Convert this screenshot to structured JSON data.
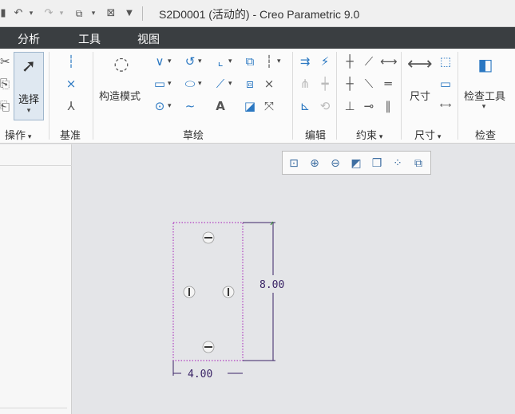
{
  "title_bar": {
    "title": "S2D0001 (活动的) - Creo Parametric 9.0"
  },
  "menu": {
    "items": [
      "分析",
      "工具",
      "视图"
    ]
  },
  "ribbon": {
    "select_label": "选择",
    "construction_mode_label": "构造模式",
    "dimension_label": "尺寸",
    "inspect_tools_label": "检查工具",
    "groups": {
      "operations": "操作",
      "datum": "基准",
      "sketch": "草绘",
      "edit": "编辑",
      "constraints": "约束",
      "dimension": "尺寸",
      "inspect": "检查"
    }
  },
  "sketch": {
    "width_dimension": "4.00",
    "height_dimension": "8.00"
  },
  "colors": {
    "menubar": "#3a3e41",
    "sketch_geometry": "#b040c0",
    "dimension": "#3a2466",
    "accent": "#2b78c2"
  }
}
